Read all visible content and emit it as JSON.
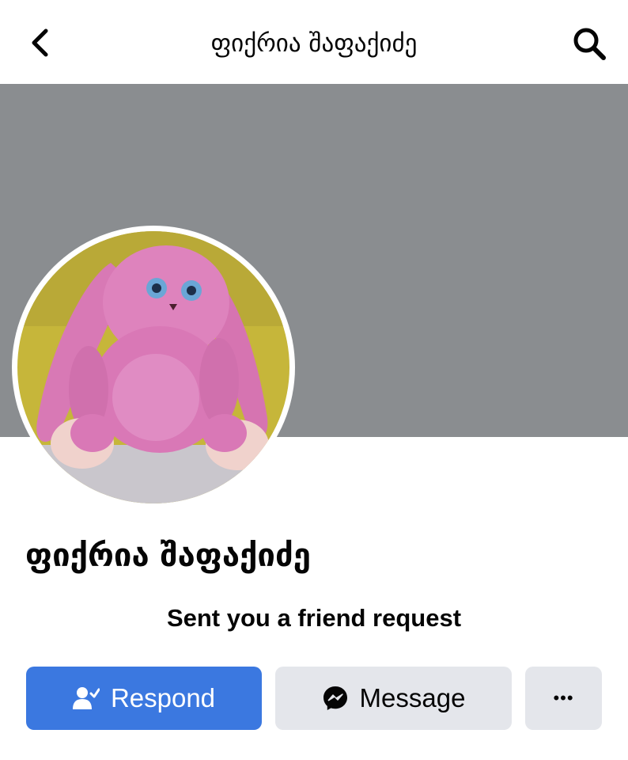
{
  "header": {
    "title": "ფიქრია შაფაქიძე",
    "back_icon": "chevron-left-icon",
    "search_icon": "search-icon"
  },
  "profile": {
    "name": "ფიქრია შაფაქიძე",
    "status_text": "Sent you a friend request",
    "avatar_description_icon": "pink-knitted-bunny-avatar"
  },
  "actions": {
    "respond_label": "Respond",
    "respond_icon": "person-check-icon",
    "message_label": "Message",
    "message_icon": "messenger-icon",
    "more_label": "•••",
    "more_icon": "more-dots-icon"
  },
  "colors": {
    "cover": "#8a8d90",
    "primary_button": "#3b78e0",
    "secondary_button": "#e4e6eb",
    "text": "#050505"
  }
}
